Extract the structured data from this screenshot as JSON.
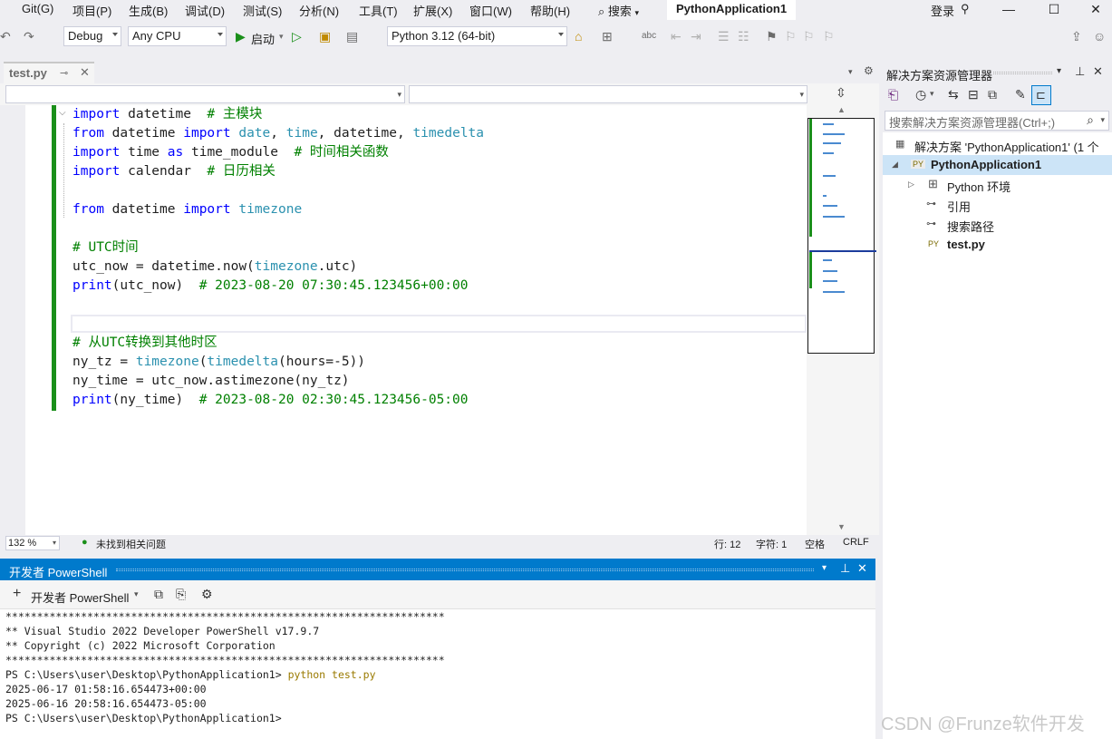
{
  "menu": {
    "items": [
      "Git(G)",
      "项目(P)",
      "生成(B)",
      "调试(D)",
      "测试(S)",
      "分析(N)",
      "工具(T)",
      "扩展(X)",
      "窗口(W)",
      "帮助(H)"
    ],
    "search_label": "搜索",
    "app_title": "PythonApplication1",
    "login_label": "登录"
  },
  "toolbar": {
    "config": "Debug",
    "platform": "Any CPU",
    "start_label": "启动",
    "python_env": "Python 3.12 (64-bit)"
  },
  "doc_tab": {
    "label": "test.py"
  },
  "code": {
    "lines": [
      [
        {
          "t": "import",
          "c": "kw"
        },
        {
          "t": " datetime  ",
          "c": "fn"
        },
        {
          "t": "# 主模块",
          "c": "cm"
        }
      ],
      [
        {
          "t": "from",
          "c": "kw"
        },
        {
          "t": " datetime ",
          "c": "fn"
        },
        {
          "t": "import",
          "c": "kw"
        },
        {
          "t": " ",
          "c": "fn"
        },
        {
          "t": "date",
          "c": "ty"
        },
        {
          "t": ", ",
          "c": "fn"
        },
        {
          "t": "time",
          "c": "ty"
        },
        {
          "t": ", datetime, ",
          "c": "fn"
        },
        {
          "t": "timedelta",
          "c": "ty"
        }
      ],
      [
        {
          "t": "import",
          "c": "kw"
        },
        {
          "t": " time ",
          "c": "fn"
        },
        {
          "t": "as",
          "c": "kw"
        },
        {
          "t": " time_module  ",
          "c": "fn"
        },
        {
          "t": "# 时间相关函数",
          "c": "cm"
        }
      ],
      [
        {
          "t": "import",
          "c": "kw"
        },
        {
          "t": " calendar  ",
          "c": "fn"
        },
        {
          "t": "# 日历相关",
          "c": "cm"
        }
      ],
      [],
      [
        {
          "t": "from",
          "c": "kw"
        },
        {
          "t": " datetime ",
          "c": "fn"
        },
        {
          "t": "import",
          "c": "kw"
        },
        {
          "t": " ",
          "c": "fn"
        },
        {
          "t": "timezone",
          "c": "ty"
        }
      ],
      [],
      [
        {
          "t": "# UTC时间",
          "c": "cm"
        }
      ],
      [
        {
          "t": "utc_now = datetime.now(",
          "c": "fn"
        },
        {
          "t": "timezone",
          "c": "ty"
        },
        {
          "t": ".utc)",
          "c": "fn"
        }
      ],
      [
        {
          "t": "print",
          "c": "bi"
        },
        {
          "t": "(utc_now)  ",
          "c": "fn"
        },
        {
          "t": "# 2023-08-20 07:30:45.123456+00:00",
          "c": "cm"
        }
      ],
      [],
      [],
      [
        {
          "t": "# 从UTC转换到其他时区",
          "c": "cm"
        }
      ],
      [
        {
          "t": "ny_tz = ",
          "c": "fn"
        },
        {
          "t": "timezone",
          "c": "ty"
        },
        {
          "t": "(",
          "c": "fn"
        },
        {
          "t": "timedelta",
          "c": "ty"
        },
        {
          "t": "(hours=-5))",
          "c": "fn"
        }
      ],
      [
        {
          "t": "ny_time = utc_now.astimezone(ny_tz)",
          "c": "fn"
        }
      ],
      [
        {
          "t": "print",
          "c": "bi"
        },
        {
          "t": "(ny_time)  ",
          "c": "fn"
        },
        {
          "t": "# 2023-08-20 02:30:45.123456-05:00",
          "c": "cm"
        }
      ]
    ]
  },
  "statusbar": {
    "zoom": "132 %",
    "issues": "未找到相关问题",
    "line": "行: 12",
    "char": "字符: 1",
    "spaces": "空格",
    "eol": "CRLF"
  },
  "powershell": {
    "title": "开发者 PowerShell",
    "new_label": "开发者 PowerShell",
    "lines": [
      "**********************************************************************",
      "** Visual Studio 2022 Developer PowerShell v17.9.7",
      "** Copyright (c) 2022 Microsoft Corporation",
      "**********************************************************************",
      "PS C:\\Users\\user\\Desktop\\PythonApplication1> ",
      "2025-06-17 01:58:16.654473+00:00",
      "2025-06-16 20:58:16.654473-05:00",
      "PS C:\\Users\\user\\Desktop\\PythonApplication1>"
    ],
    "command": "python test.py"
  },
  "solution_explorer": {
    "title": "解决方案资源管理器",
    "search_placeholder": "搜索解决方案资源管理器(Ctrl+;)",
    "nodes": {
      "solution": "解决方案 'PythonApplication1' (1 个",
      "project": "PythonApplication1",
      "env": "Python 环境",
      "refs": "引用",
      "search_paths": "搜索路径",
      "file": "test.py"
    }
  },
  "watermark": "CSDN @Frunze软件开发"
}
